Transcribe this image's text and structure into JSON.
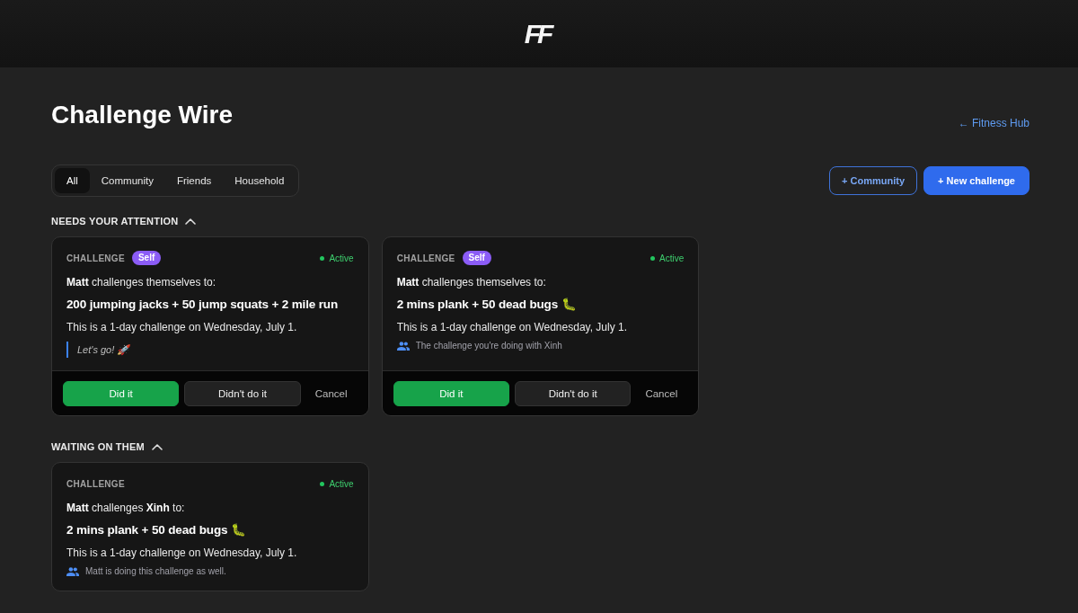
{
  "header": {
    "logo": "FF"
  },
  "page": {
    "title": "Challenge Wire",
    "back_link": "← Fitness Hub"
  },
  "tabs": [
    {
      "label": "All",
      "selected": true
    },
    {
      "label": "Community",
      "selected": false
    },
    {
      "label": "Friends",
      "selected": false
    },
    {
      "label": "Household",
      "selected": false
    }
  ],
  "actions": [
    {
      "label": "+ Community",
      "kind": "outline"
    },
    {
      "label": "+ New challenge",
      "kind": "primary"
    }
  ],
  "sections": [
    {
      "heading": "NEEDS YOUR ATTENTION",
      "expanded": true,
      "cards": [
        {
          "label": "CHALLENGE",
          "badge": "Self",
          "status": "Active",
          "intro": "**Matt** challenges themselves to:",
          "title": "200 jumping jacks + 50 jump squats + 2 mile run",
          "schedule": "This is a 1-day challenge on Wednesday, July 1.",
          "note": {
            "kind": "quote",
            "text": "Let's go! 🚀"
          },
          "buttons": [
            {
              "label": "Did it",
              "kind": "success"
            },
            {
              "label": "Didn't do it",
              "kind": "secondary"
            },
            {
              "label": "Cancel",
              "kind": "text"
            }
          ]
        },
        {
          "label": "CHALLENGE",
          "badge": "Self",
          "status": "Active",
          "intro": "**Matt** challenges themselves to:",
          "title": "2 mins plank + 50 dead bugs 🐛",
          "schedule": "This is a 1-day challenge on Wednesday, July 1.",
          "note": {
            "kind": "people",
            "text": "The challenge you're doing with Xinh"
          },
          "buttons": [
            {
              "label": "Did it",
              "kind": "success"
            },
            {
              "label": "Didn't do it",
              "kind": "secondary"
            },
            {
              "label": "Cancel",
              "kind": "text"
            }
          ]
        }
      ]
    },
    {
      "heading": "WAITING ON THEM",
      "expanded": true,
      "cards": [
        {
          "label": "CHALLENGE",
          "status": "Active",
          "intro": "**Matt** challenges **Xinh** to:",
          "title": "2 mins plank + 50 dead bugs 🐛",
          "schedule": "This is a 1-day challenge on Wednesday, July 1.",
          "note": {
            "kind": "people",
            "text": "Matt is doing this challenge as well."
          }
        }
      ]
    }
  ]
}
